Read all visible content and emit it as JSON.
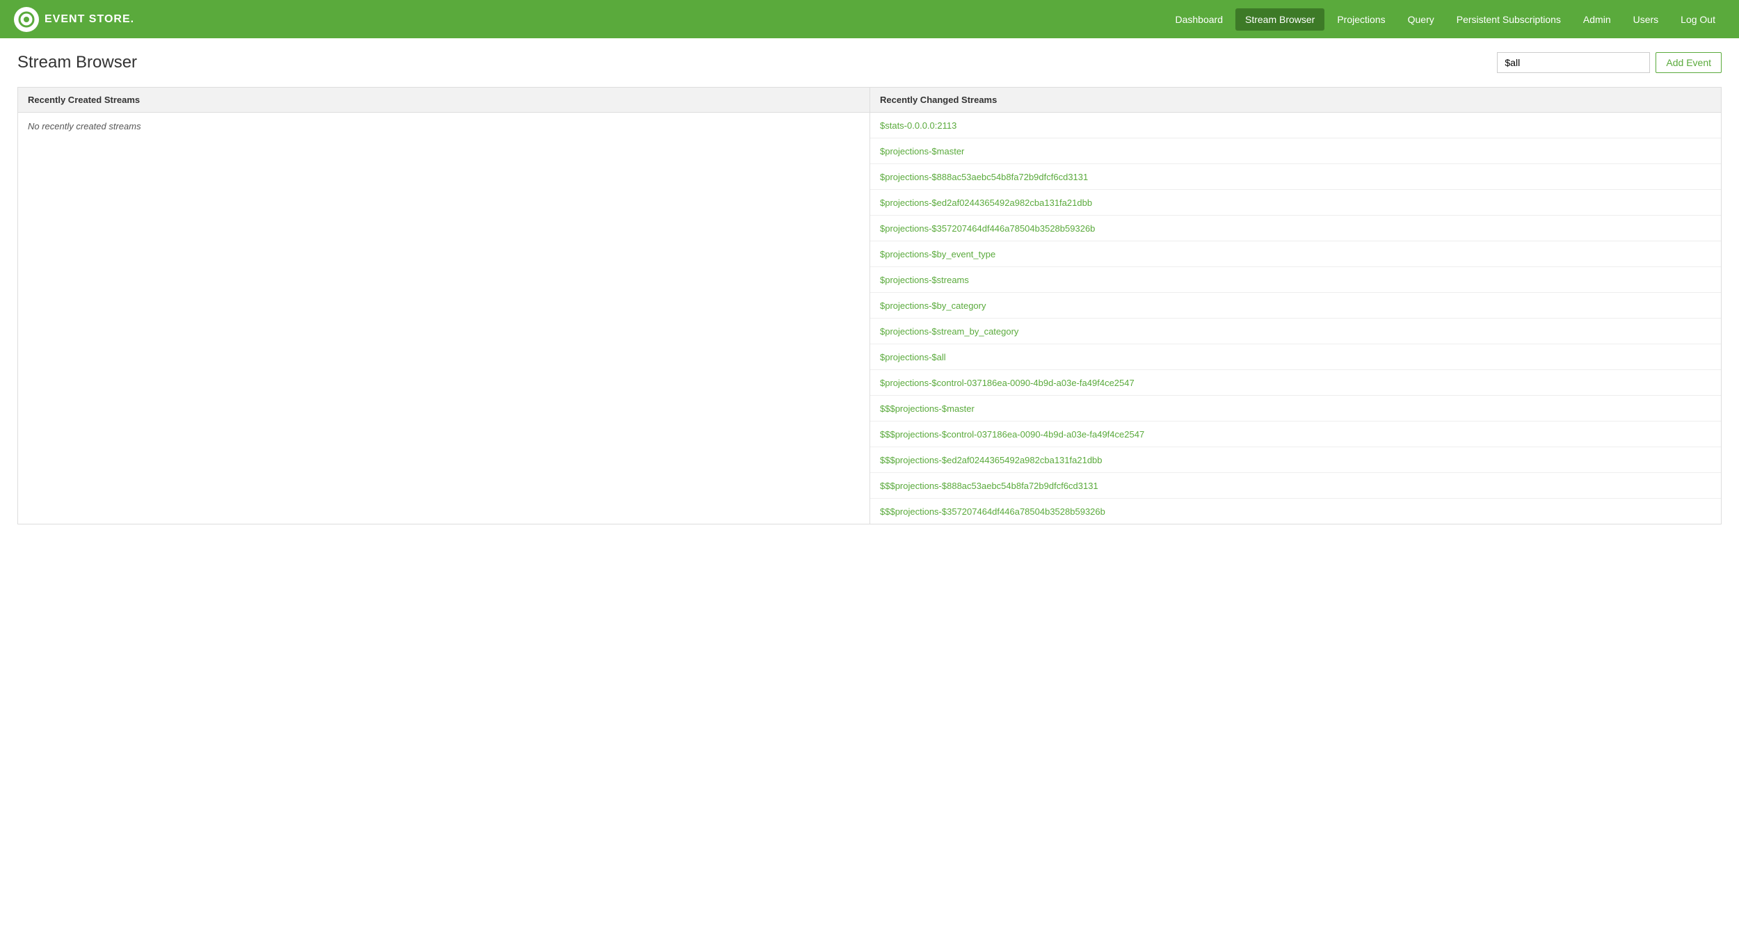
{
  "navbar": {
    "brand": "EVENT STORE.",
    "nav_items": [
      {
        "id": "dashboard",
        "label": "Dashboard",
        "active": false
      },
      {
        "id": "stream-browser",
        "label": "Stream Browser",
        "active": true
      },
      {
        "id": "projections",
        "label": "Projections",
        "active": false
      },
      {
        "id": "query",
        "label": "Query",
        "active": false
      },
      {
        "id": "persistent-subscriptions",
        "label": "Persistent Subscriptions",
        "active": false
      },
      {
        "id": "admin",
        "label": "Admin",
        "active": false
      },
      {
        "id": "users",
        "label": "Users",
        "active": false
      },
      {
        "id": "log-out",
        "label": "Log Out",
        "active": false
      }
    ]
  },
  "page": {
    "title": "Stream Browser",
    "search_placeholder": "$all",
    "add_event_label": "Add Event"
  },
  "recently_created": {
    "header": "Recently Created Streams",
    "empty_message": "No recently created streams",
    "streams": []
  },
  "recently_changed": {
    "header": "Recently Changed Streams",
    "streams": [
      {
        "name": "$stats-0.0.0.0:2113"
      },
      {
        "name": "$projections-$master"
      },
      {
        "name": "$projections-$888ac53aebc54b8fa72b9dfcf6cd3131"
      },
      {
        "name": "$projections-$ed2af0244365492a982cba131fa21dbb"
      },
      {
        "name": "$projections-$357207464df446a78504b3528b59326b"
      },
      {
        "name": "$projections-$by_event_type"
      },
      {
        "name": "$projections-$streams"
      },
      {
        "name": "$projections-$by_category"
      },
      {
        "name": "$projections-$stream_by_category"
      },
      {
        "name": "$projections-$all"
      },
      {
        "name": "$projections-$control-037186ea-0090-4b9d-a03e-fa49f4ce2547"
      },
      {
        "name": "$$$projections-$master"
      },
      {
        "name": "$$$projections-$control-037186ea-0090-4b9d-a03e-fa49f4ce2547"
      },
      {
        "name": "$$$projections-$ed2af0244365492a982cba131fa21dbb"
      },
      {
        "name": "$$$projections-$888ac53aebc54b8fa72b9dfcf6cd3131"
      },
      {
        "name": "$$$projections-$357207464df446a78504b3528b59326b"
      }
    ]
  }
}
